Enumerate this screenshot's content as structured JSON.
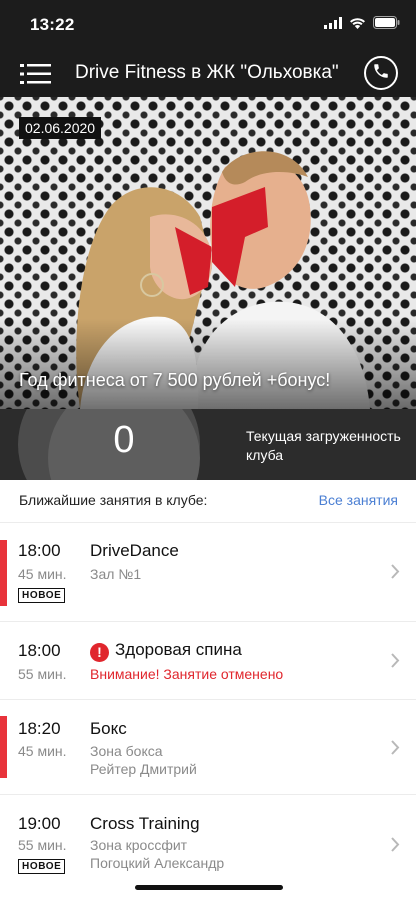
{
  "status": {
    "time": "13:22"
  },
  "header": {
    "title": "Drive Fitness в ЖК \"Ольховка\""
  },
  "banner": {
    "date": "02.06.2020",
    "caption": "Год фитнеса от 7 500 рублей +бонус!"
  },
  "load": {
    "value": "0",
    "label": "Текущая загруженность клуба"
  },
  "classes_section": {
    "title": "Ближайшие занятия в клубе:",
    "all_link": "Все занятия"
  },
  "classes": [
    {
      "time": "18:00",
      "duration": "45 мин.",
      "badge": "НОВОЕ",
      "name": "DriveDance",
      "place": "Зал №1",
      "trainer": "",
      "warning": ""
    },
    {
      "time": "18:00",
      "duration": "55 мин.",
      "badge": "",
      "name": "Здоровая спина",
      "place": "",
      "trainer": "",
      "warning": "Внимание! Занятие отменено"
    },
    {
      "time": "18:20",
      "duration": "45 мин.",
      "badge": "",
      "name": "Бокс",
      "place": "Зона бокса",
      "trainer": "Рейтер Дмитрий",
      "warning": ""
    },
    {
      "time": "19:00",
      "duration": "55 мин.",
      "badge": "НОВОЕ",
      "name": "Cross Training",
      "place": "Зона кроссфит",
      "trainer": "Погоцкий  Александр",
      "warning": ""
    }
  ],
  "colors": {
    "accent": "#e8333b",
    "link": "#4b7fd3",
    "warning": "#e0262d",
    "header_bg": "#1c1c1c"
  },
  "icons": [
    "menu-icon",
    "phone-icon",
    "wifi-icon",
    "battery-icon",
    "signal-icon",
    "alert-icon",
    "chevron-right-icon"
  ]
}
